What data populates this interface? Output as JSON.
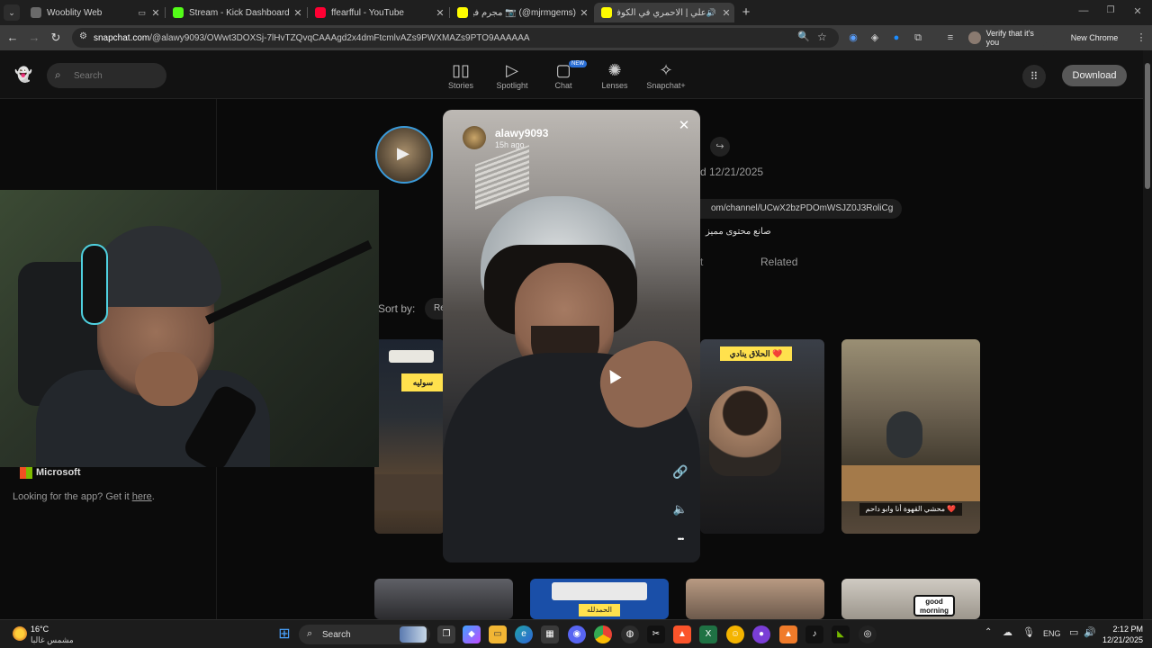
{
  "browser": {
    "tabs": [
      {
        "title": "Wooblity Web",
        "color": "#6a6a6a"
      },
      {
        "title": "Stream - Kick Dashboard",
        "color": "#53fc18"
      },
      {
        "title": "ffearfful - YouTube",
        "color": "#ff0033"
      },
      {
        "title": "(mjrmgems@) 📷 مجرم فيمز |",
        "color": "#fffc00"
      },
      {
        "title": "علي | الاحمري في الكوفان ء ءء",
        "color": "#fffc00"
      }
    ],
    "new_tab": "+",
    "url_host": "snapchat.com",
    "url_path": "/@alawy9093/OWwt3DOXSj-7lHvTZQvqCAAAgd2x4dmFtcmlvAZs9PWXMAZs9PTO9AAAAAA",
    "verify_label": "Verify that it's you",
    "new_chrome_label": "New Chrome available"
  },
  "snap_nav": {
    "search_placeholder": "Search",
    "items": [
      {
        "label": "Stories",
        "icon": "stories-icon",
        "glyph": "▯▯"
      },
      {
        "label": "Spotlight",
        "icon": "spotlight-icon",
        "glyph": "▷"
      },
      {
        "label": "Chat",
        "icon": "chat-icon",
        "glyph": "▢",
        "badge": "NEW"
      },
      {
        "label": "Lenses",
        "icon": "lenses-icon",
        "glyph": "✺"
      },
      {
        "label": "Snapchat+",
        "icon": "snapchat-plus-icon",
        "glyph": "✧"
      }
    ],
    "download_label": "Download"
  },
  "profile": {
    "date": "d 12/21/2025",
    "channel_link": "om/channel/UCwX2bzPDOmWSJZ0J3RoliCg",
    "bio": "صانع محتوى مميز",
    "tab_partial": "t",
    "tab_related": "Related",
    "sort_label": "Sort by:",
    "sort_value": "Re"
  },
  "left": {
    "ms_label": "Microsoft",
    "app_text": "Looking for the app? Get it ",
    "app_link": "here",
    "app_end": "."
  },
  "thumbs": [
    {
      "caption": "سوليه",
      "badge_color": "#ffe14d"
    },
    {
      "caption": "الحلاق ينادي ❤️",
      "badge_color": "#ffe14d"
    },
    {
      "caption": "❤️ محشي القهوة أنا وابو داحم"
    },
    {
      "caption": "الحمدلله"
    },
    {
      "caption": "good morning"
    }
  ],
  "story": {
    "username": "alawy9093",
    "time_ago": "15h ago",
    "close": "✕",
    "more": "•••"
  },
  "taskbar": {
    "weather_temp": "16°C",
    "weather_desc": "مشمس غالبا",
    "search_label": "Search",
    "lang": "ENG",
    "time": "2:12 PM",
    "date": "12/21/2025"
  }
}
